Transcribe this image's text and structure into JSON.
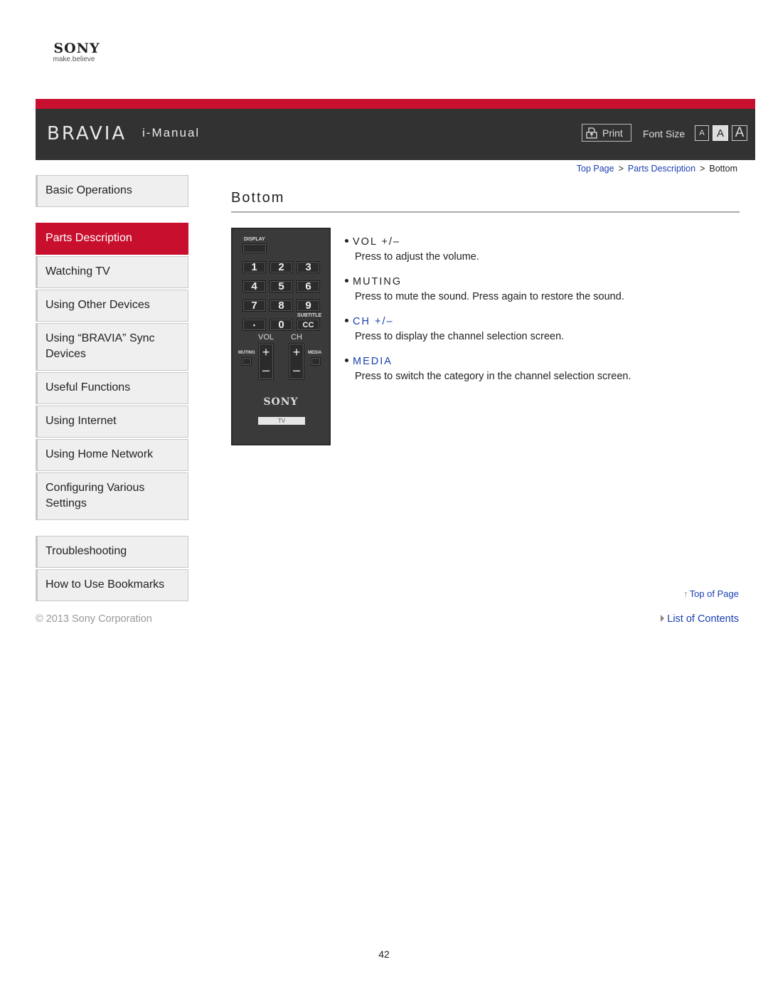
{
  "logo": {
    "brand": "SONY",
    "tagline": "make.believe"
  },
  "header": {
    "product": "BRAVIA",
    "title": "i-Manual",
    "print_label": "Print",
    "font_size_label": "Font Size",
    "font_size_options": [
      "A",
      "A",
      "A"
    ],
    "accent_color": "#c8102e"
  },
  "breadcrumb": {
    "items": [
      "Top Page",
      "Parts Description"
    ],
    "current": "Bottom",
    "separator": ">"
  },
  "sidebar": {
    "items": [
      {
        "label": "Basic Operations"
      },
      {
        "label": "Parts Description",
        "active": true
      },
      {
        "label": "Watching TV"
      },
      {
        "label": "Using Other Devices"
      },
      {
        "label": "Using “BRAVIA” Sync Devices"
      },
      {
        "label": "Useful Functions"
      },
      {
        "label": "Using Internet"
      },
      {
        "label": "Using Home Network"
      },
      {
        "label": "Configuring Various Settings"
      },
      {
        "label": "Troubleshooting"
      },
      {
        "label": "How to Use Bookmarks"
      }
    ]
  },
  "page": {
    "title": "Bottom"
  },
  "remote": {
    "display_label": "DISPLAY",
    "keys": [
      "1",
      "2",
      "3",
      "4",
      "5",
      "6",
      "7",
      "8",
      "9",
      "•",
      "0",
      "CC"
    ],
    "subtitle_label": "SUBTITLE",
    "vol_label": "VOL",
    "ch_label": "CH",
    "muting_label": "MUTING",
    "media_label": "MEDIA",
    "plus": "+",
    "minus": "–",
    "brand": "SONY",
    "plate": "TV"
  },
  "items": [
    {
      "name": "VOL +/–",
      "desc": "Press to adjust the volume.",
      "link": false
    },
    {
      "name": "MUTING",
      "desc": "Press to mute the sound. Press again to restore the sound.",
      "link": false
    },
    {
      "name": "CH +/–",
      "desc": "Press to display the channel selection screen.",
      "link": true
    },
    {
      "name": "MEDIA",
      "desc": "Press to switch the category in the channel selection screen.",
      "link": true
    }
  ],
  "footer": {
    "top_of_page": "Top of Page",
    "list_of_contents": "List of Contents",
    "copyright": "© 2013 Sony Corporation",
    "page_number": "42"
  }
}
